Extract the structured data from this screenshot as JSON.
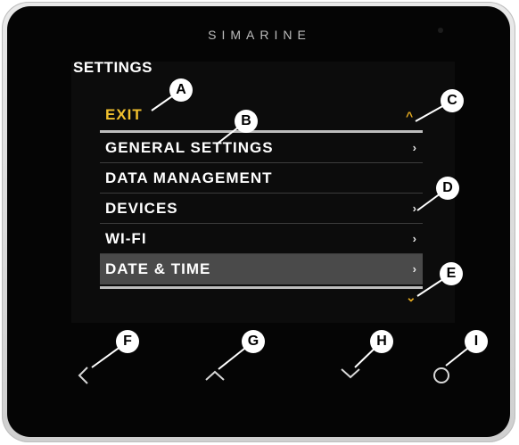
{
  "device": {
    "brand": "SIMARINE"
  },
  "screen": {
    "title": "SETTINGS",
    "menu": [
      {
        "label": "EXIT"
      },
      {
        "label": "GENERAL SETTINGS",
        "chevron": "›"
      },
      {
        "label": "DATA MANAGEMENT"
      },
      {
        "label": "DEVICES",
        "chevron": "›"
      },
      {
        "label": "WI-FI",
        "chevron": "›"
      },
      {
        "label": "DATE & TIME",
        "chevron": "›",
        "selected": true
      }
    ],
    "scroll_up": "^",
    "scroll_down": "⌄"
  },
  "buttons": [
    {
      "name": "back-button",
      "icon": "chevron-left-icon"
    },
    {
      "name": "up-button",
      "icon": "chevron-up-icon"
    },
    {
      "name": "down-button",
      "icon": "chevron-down-icon"
    },
    {
      "name": "select-button",
      "icon": "circle-icon"
    }
  ],
  "callouts": [
    "A",
    "B",
    "C",
    "D",
    "E",
    "F",
    "G",
    "H",
    "I"
  ],
  "colors": {
    "accent": "#f2c12e",
    "selected_bg": "#4a4a4a",
    "face": "#050505"
  }
}
